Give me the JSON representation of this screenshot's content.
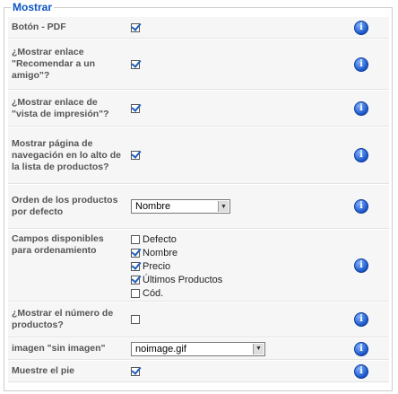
{
  "panel": {
    "legend": "Mostrar"
  },
  "rows": [
    {
      "label": "Botón - PDF",
      "checked": true
    },
    {
      "label": "¿Mostrar enlace \"Recomendar a un amigo\"?",
      "checked": true
    },
    {
      "label": "¿Mostrar enlace de \"vista de impresión\"?",
      "checked": true
    },
    {
      "label": "Mostrar página de navegación en lo alto de la lista de productos?",
      "checked": true
    },
    {
      "label": "Orden de los productos por defecto",
      "select_value": "Nombre"
    },
    {
      "label": "Campos disponibles para ordenamiento"
    },
    {
      "label": "¿Mostrar el número de productos?",
      "checked": false
    },
    {
      "label": "imagen \"sin imagen\"",
      "select_value": "noimage.gif"
    },
    {
      "label": "Muestre el pie",
      "checked": true
    }
  ],
  "sort_fields": [
    {
      "label": "Defecto",
      "checked": false
    },
    {
      "label": "Nombre",
      "checked": true
    },
    {
      "label": "Precio",
      "checked": true
    },
    {
      "label": "Últimos Productos",
      "checked": true
    },
    {
      "label": "Cód.",
      "checked": false
    }
  ],
  "icons": {
    "info": "info-icon",
    "info_glyph": "i"
  },
  "colors": {
    "legend": "#0b55c4",
    "row_bg": "#f6f6f6",
    "info_blue": "#1a56c8"
  }
}
